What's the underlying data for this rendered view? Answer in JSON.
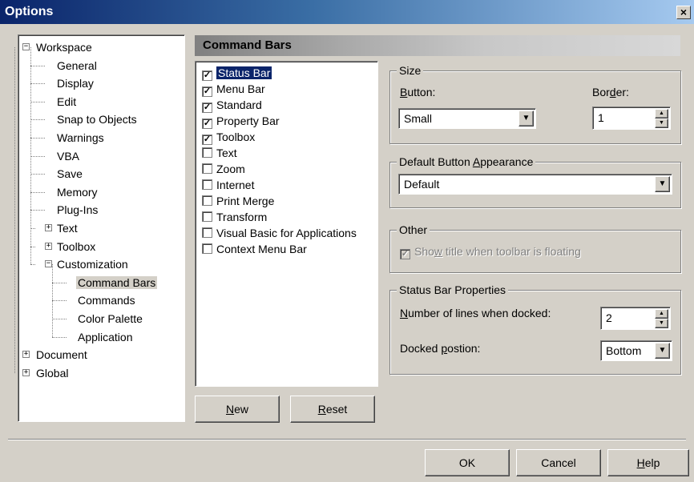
{
  "window": {
    "title": "Options",
    "close_glyph": "×"
  },
  "tree": {
    "items": [
      {
        "label": "Workspace",
        "expander": "−"
      },
      {
        "label": "General"
      },
      {
        "label": "Display"
      },
      {
        "label": "Edit"
      },
      {
        "label": "Snap to Objects"
      },
      {
        "label": "Warnings"
      },
      {
        "label": "VBA"
      },
      {
        "label": "Save"
      },
      {
        "label": "Memory"
      },
      {
        "label": "Plug-Ins"
      },
      {
        "label": "Text",
        "expander": "+"
      },
      {
        "label": "Toolbox",
        "expander": "+"
      },
      {
        "label": "Customization",
        "expander": "−"
      },
      {
        "label": "Command Bars",
        "selected": true
      },
      {
        "label": "Commands"
      },
      {
        "label": "Color Palette"
      },
      {
        "label": "Application"
      },
      {
        "label": "Document",
        "expander": "+"
      },
      {
        "label": "Global",
        "expander": "+"
      }
    ]
  },
  "panel": {
    "title": "Command Bars"
  },
  "command_bars": [
    {
      "label": "Status Bar",
      "checked": true,
      "selected": true
    },
    {
      "label": "Menu Bar",
      "checked": true
    },
    {
      "label": "Standard",
      "checked": true
    },
    {
      "label": "Property Bar",
      "checked": true
    },
    {
      "label": "Toolbox",
      "checked": true
    },
    {
      "label": "Text",
      "checked": false
    },
    {
      "label": "Zoom",
      "checked": false
    },
    {
      "label": "Internet",
      "checked": false
    },
    {
      "label": "Print Merge",
      "checked": false
    },
    {
      "label": "Transform",
      "checked": false
    },
    {
      "label": "Visual Basic for Applications",
      "checked": false
    },
    {
      "label": "Context Menu Bar",
      "checked": false
    }
  ],
  "check_glyph": "✓",
  "list_buttons": {
    "new": {
      "mnemonic": "N",
      "rest": "ew"
    },
    "reset": {
      "mnemonic": "R",
      "rest": "eset"
    }
  },
  "size_group": {
    "title": "Size",
    "button_label": {
      "mnemonic": "B",
      "rest": "utton:"
    },
    "button_value": "Small",
    "border_label": {
      "pre": "Bor",
      "mnemonic": "d",
      "rest": "er:"
    },
    "border_value": "1"
  },
  "appearance_group": {
    "title": {
      "pre": "Default Button ",
      "mnemonic": "A",
      "rest": "ppearance"
    },
    "value": "Default"
  },
  "other_group": {
    "title": "Other",
    "checkbox": {
      "pre": "Sho",
      "mnemonic": "w",
      "rest": " title when toolbar is floating",
      "checked": true,
      "enabled": false
    }
  },
  "status_group": {
    "title": "Status Bar Properties",
    "lines_label": {
      "mnemonic": "N",
      "rest": "umber of lines when docked:"
    },
    "lines_value": "2",
    "position_label": {
      "pre": "Docked ",
      "mnemonic": "p",
      "rest": "ostion:"
    },
    "position_value": "Bottom"
  },
  "footer": {
    "ok": "OK",
    "cancel": "Cancel",
    "help": {
      "mnemonic": "H",
      "rest": "elp"
    }
  },
  "glyphs": {
    "drop": "▼",
    "spin_up": "▲",
    "spin_down": "▼"
  }
}
